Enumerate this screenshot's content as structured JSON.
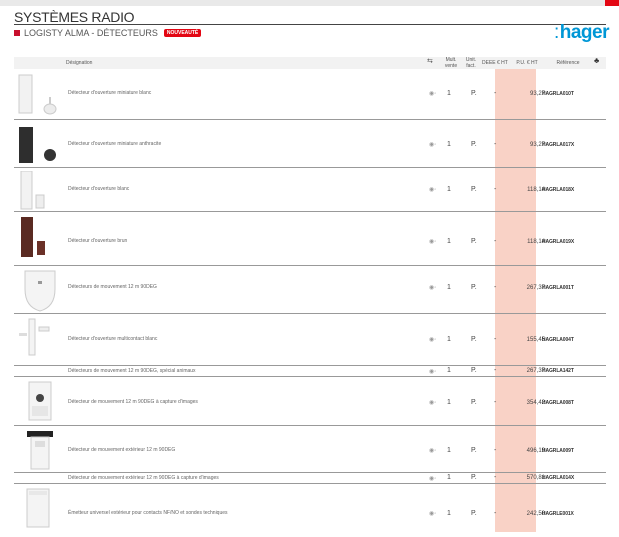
{
  "section": {
    "title": "SYSTÈMES RADIO"
  },
  "subtitle": {
    "label": "LOGISTY ALMA - DÉTECTEURS",
    "badge": "NOUVEAUTÉ"
  },
  "brand": {
    "logo": "hager",
    "logo_mark": ":"
  },
  "header": {
    "designation": "Désignation",
    "radio_icon": "⇆",
    "multiple_sale": "Mult. vente",
    "unit": "Unit. fact.",
    "deee": "DEEE € HT",
    "price": "P.U. € HT",
    "reference": "Référence",
    "family_icon": "♣"
  },
  "colors": {
    "brand_blue": "#0097d6",
    "accent_red": "#e30613",
    "price_column": "#f9d2c6"
  },
  "rows": [
    {
      "desc": "Détecteur d'ouverture miniature blanc",
      "radio": "◉◦",
      "qty": "1",
      "pkg": "P.",
      "deee": "-",
      "price": "93,27",
      "ref": "HAGRLA010T"
    },
    {
      "desc": "Détecteur d'ouverture miniature anthracite",
      "radio": "◉◦",
      "qty": "1",
      "pkg": "P.",
      "deee": "-",
      "price": "93,27",
      "ref": "HAGRLA017X"
    },
    {
      "desc": "Détecteur d'ouverture blanc",
      "radio": "◉◦",
      "qty": "1",
      "pkg": "P.",
      "deee": "-",
      "price": "118,14",
      "ref": "HAGRLA018X"
    },
    {
      "desc": "Détecteur d'ouverture brun",
      "radio": "◉◦",
      "qty": "1",
      "pkg": "P.",
      "deee": "-",
      "price": "118,14",
      "ref": "HAGRLA019X"
    },
    {
      "desc": "Détecteurs de mouvement 12 m 90DEG",
      "radio": "◉◦",
      "qty": "1",
      "pkg": "P.",
      "deee": "-",
      "price": "267,37",
      "ref": "HAGRLA001T"
    },
    {
      "desc": "Détecteur d'ouverture multicontact blanc",
      "radio": "◉◦",
      "qty": "1",
      "pkg": "P.",
      "deee": "-",
      "price": "155,45",
      "ref": "HAGRLA004T"
    },
    {
      "desc": "Détecteurs de mouvement 12 m 90DEG, spécial animaux",
      "radio": "◉◦",
      "qty": "1",
      "pkg": "P.",
      "deee": "-",
      "price": "267,37",
      "ref": "HAGRLA142T"
    },
    {
      "desc": "Détecteur de mouvement 12 m 90DEG à capture d'images",
      "radio": "◉◦",
      "qty": "1",
      "pkg": "P.",
      "deee": "-",
      "price": "354,42",
      "ref": "HAGRLA008T"
    },
    {
      "desc": "Détecteur de mouvement extérieur 12 m 90DEG",
      "radio": "◉◦",
      "qty": "1",
      "pkg": "P.",
      "deee": "-",
      "price": "496,19",
      "ref": "HAGRLA009T"
    },
    {
      "desc": "Détecteur de mouvement extérieur 12 m 90DEG à capture d'images",
      "radio": "◉◦",
      "qty": "1",
      "pkg": "P.",
      "deee": "-",
      "price": "570,81",
      "ref": "HAGRLA014X"
    },
    {
      "desc": "Émetteur universel extérieur pour contacts NF/NO et sondes techniques",
      "radio": "◉◦",
      "qty": "1",
      "pkg": "P.",
      "deee": "-",
      "price": "242,50",
      "ref": "HAGRLE001X"
    }
  ]
}
